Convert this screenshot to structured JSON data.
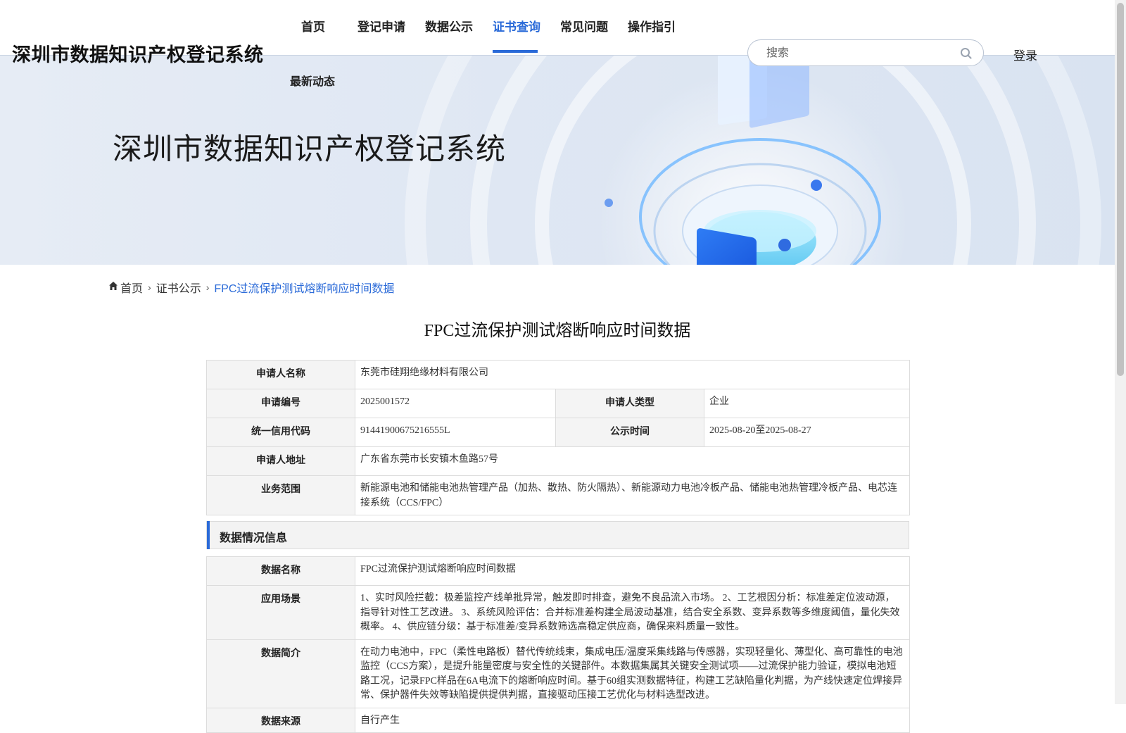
{
  "header": {
    "site_title": "深圳市数据知识产权登记系统",
    "nav": [
      {
        "label": "首页"
      },
      {
        "label": "登记申请"
      },
      {
        "label": "数据公示"
      },
      {
        "label": "证书查询",
        "active": true
      },
      {
        "label": "常见问题"
      },
      {
        "label": "操作指引"
      },
      {
        "label": "最新动态"
      }
    ],
    "search": {
      "placeholder": "搜索",
      "value": ""
    },
    "login_label": "登录"
  },
  "banner": {
    "title": "深圳市数据知识产权登记系统"
  },
  "breadcrumb": {
    "home": "首页",
    "parent": "证书公示",
    "current": "FPC过流保护测试熔断响应时间数据"
  },
  "page_title": "FPC过流保护测试熔断响应时间数据",
  "applicant_info": {
    "name_label": "申请人名称",
    "name_value": "东莞市硅翔绝缘材料有限公司",
    "app_no_label": "申请编号",
    "app_no_value": "2025001572",
    "type_label": "申请人类型",
    "type_value": "企业",
    "credit_label": "统一信用代码",
    "credit_value": "91441900675216555L",
    "pub_label": "公示时间",
    "pub_value": "2025-08-20至2025-08-27",
    "addr_label": "申请人地址",
    "addr_value": "广东省东莞市长安镇木鱼路57号",
    "scope_label": "业务范围",
    "scope_value": "新能源电池和储能电池热管理产品（加热、散热、防火隔热）、新能源动力电池冷板产品、储能电池热管理冷板产品、电芯连接系统（CCS/FPC）"
  },
  "data_section": {
    "title": "数据情况信息",
    "name_label": "数据名称",
    "name_value": "FPC过流保护测试熔断响应时间数据",
    "scene_label": "应用场景",
    "scene_value": "1、实时风险拦截：极差监控产线单批异常，触发即时排查，避免不良品流入市场。 2、工艺根因分析：标准差定位波动源，指导针对性工艺改进。 3、系统风险评估：合并标准差构建全局波动基准，结合安全系数、变异系数等多维度阈值，量化失效概率。 4、供应链分级：基于标准差/变异系数筛选高稳定供应商，确保来料质量一致性。",
    "intro_label": "数据简介",
    "intro_value": "在动力电池中，FPC（柔性电路板）替代传统线束，集成电压/温度采集线路与传感器，实现轻量化、薄型化、高可靠性的电池监控（CCS方案），是提升能量密度与安全性的关键部件。本数据集属其关键安全测试项——过流保护能力验证，模拟电池短路工况，记录FPC样品在6A电流下的熔断响应时间。基于60组实测数据特征，构建工艺缺陷量化判据，为产线快速定位焊接异常、保护器件失效等缺陷提供提供判据，直接驱动压接工艺优化与材料选型改进。",
    "source_label": "数据来源",
    "source_value": "自行产生"
  },
  "colors": {
    "accent": "#2a6ad8",
    "label_bg": "#f4f4f4",
    "border": "#dcdcdc"
  }
}
